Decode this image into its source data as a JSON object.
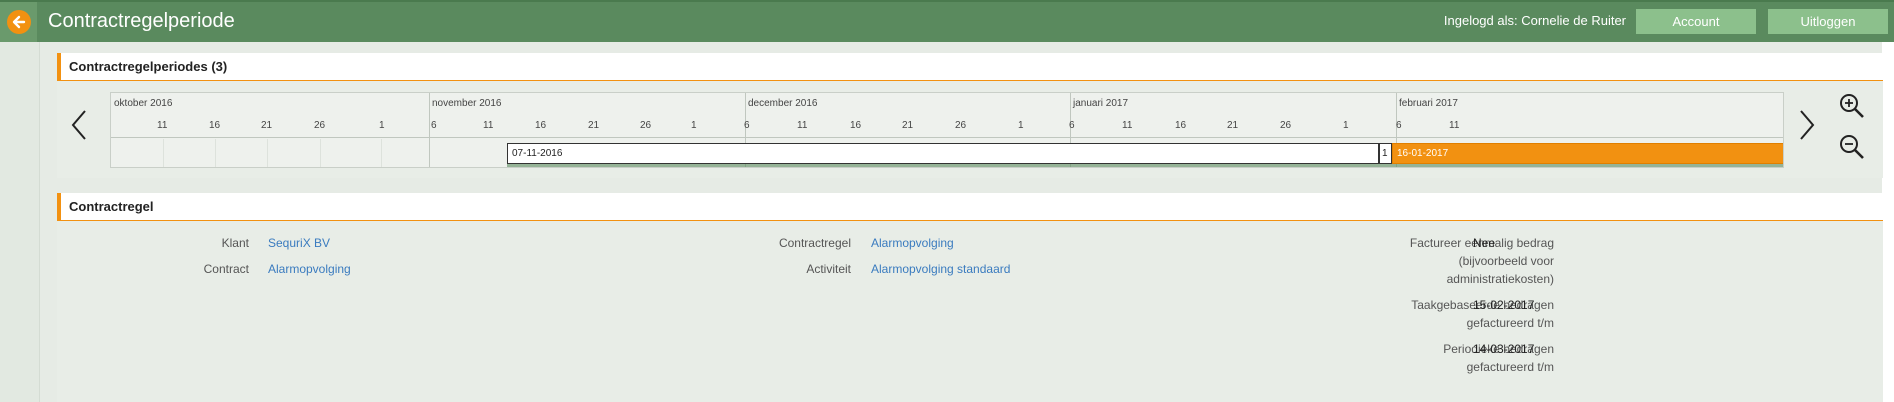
{
  "header": {
    "title": "Contractregelperiode",
    "logged_in": "Ingelogd als: Cornelie de Ruiter",
    "account_label": "Account",
    "logout_label": "Uitloggen"
  },
  "timeline": {
    "title": "Contractregelperiodes (3)",
    "months": [
      "oktober 2016",
      "november 2016",
      "december 2016",
      "januari 2017",
      "februari 2017"
    ],
    "ticks": [
      "11",
      "16",
      "21",
      "26",
      "1",
      "6",
      "11",
      "16",
      "21",
      "26",
      "1",
      "6",
      "11",
      "16",
      "21",
      "26",
      "1",
      "6",
      "11",
      "16",
      "21",
      "26",
      "1",
      "6",
      "11"
    ],
    "bars": [
      {
        "label": "07-11-2016"
      },
      {
        "label": "1"
      },
      {
        "label": "16-01-2017"
      }
    ]
  },
  "detail": {
    "title": "Contractregel",
    "klant_label": "Klant",
    "klant_value": "SequriX BV",
    "contract_label": "Contract",
    "contract_value": "Alarmopvolging",
    "contractregel_label": "Contractregel",
    "contractregel_value": "Alarmopvolging",
    "activiteit_label": "Activiteit",
    "activiteit_value": "Alarmopvolging standaard",
    "eenmalig_label_1": "Factureer eenmalig bedrag",
    "eenmalig_label_2": "(bijvoorbeeld voor",
    "eenmalig_label_3": "administratiekosten)",
    "eenmalig_value": "Nee",
    "taak_label_1": "Taakgebaseerde bedragen",
    "taak_label_2": "gefactureerd t/m",
    "taak_value": "15-02-2017",
    "periodiek_label_1": "Periodieke bedragen",
    "periodiek_label_2": "gefactureerd t/m",
    "periodiek_value": "14-03-2017"
  },
  "icons": {
    "back": "arrow-left-icon",
    "prev": "chevron-left-icon",
    "next": "chevron-right-icon",
    "zoom_in": "zoom-in-icon",
    "zoom_out": "zoom-out-icon"
  },
  "colors": {
    "header": "#5a8a5e",
    "accent": "#f29111",
    "button": "#8cc08c",
    "link": "#3a7bbf"
  }
}
